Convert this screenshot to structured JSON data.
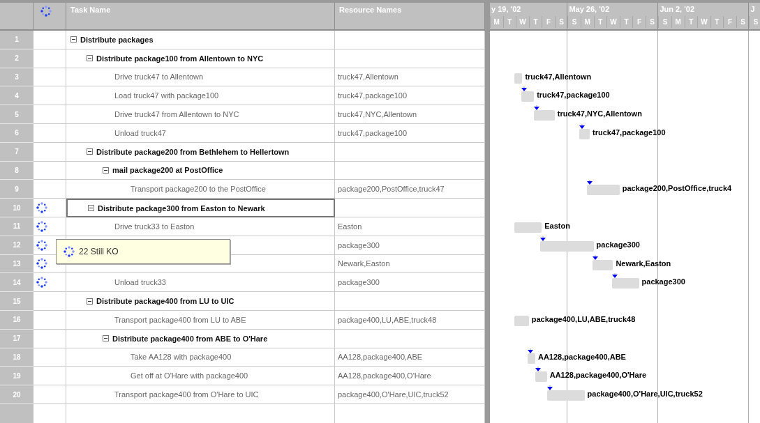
{
  "table": {
    "columns": [
      "Task Name",
      "Resource Names"
    ],
    "rows": [
      {
        "id": "1",
        "name": "Distribute packages",
        "indicator": false,
        "selected": false,
        "expanded": true,
        "children": [
          {
            "id": "2",
            "name": "Distribute package100 from Allentown to NYC",
            "indicator": false,
            "selected": false,
            "expanded": true,
            "children": [
              {
                "id": "3",
                "name": "Drive truck47 to Allentown",
                "resources": "truck47,Allentown",
                "indicator": false,
                "selected": false,
                "bar": {
                  "label": "truck47,Allentown",
                  "linked": false
                }
              },
              {
                "id": "4",
                "name": "Load truck47 with package100",
                "resources": "truck47,package100",
                "indicator": false,
                "selected": false,
                "bar": {
                  "label": "truck47,package100",
                  "linked": true
                }
              },
              {
                "id": "5",
                "name": "Drive truck47 from Allentown to NYC",
                "resources": "truck47,NYC,Allentown",
                "indicator": false,
                "selected": false,
                "bar": {
                  "label": "truck47,NYC,Allentown",
                  "linked": true
                }
              },
              {
                "id": "6",
                "name": "Unload truck47",
                "resources": "truck47,package100",
                "indicator": false,
                "selected": false,
                "bar": {
                  "label": "truck47,package100",
                  "linked": true
                }
              }
            ]
          },
          {
            "id": "7",
            "name": "Distribute package200 from Bethlehem to Hellertown",
            "indicator": false,
            "selected": false,
            "expanded": true,
            "children": [
              {
                "id": "8",
                "name": "mail package200 at PostOffice",
                "indicator": false,
                "selected": false,
                "expanded": true,
                "children": [
                  {
                    "id": "9",
                    "name": "Transport package200 to the PostOffice",
                    "resources": "package200,PostOffice,truck47",
                    "indicator": false,
                    "selected": false,
                    "bar": {
                      "label": "package200,PostOffice,truck4",
                      "linked": true
                    }
                  }
                ]
              }
            ]
          },
          {
            "id": "10",
            "name": "Distribute package300 from Easton to Newark",
            "indicator": true,
            "selected": true,
            "expanded": true,
            "children": [
              {
                "id": "11",
                "name": "Drive truck33 to Easton",
                "resources": "Easton",
                "indicator": true,
                "selected": false,
                "bar": {
                  "label": "Easton",
                  "linked": false
                }
              },
              {
                "id": "12",
                "resources": "package300",
                "indicator": true,
                "selected": false,
                "bar": {
                  "label": "package300",
                  "linked": true
                }
              },
              {
                "id": "13",
                "resources": "Newark,Easton",
                "indicator": true,
                "selected": false,
                "bar": {
                  "label": "Newark,Easton",
                  "linked": true
                }
              },
              {
                "id": "14",
                "name": "Unload truck33",
                "resources": "package300",
                "indicator": true,
                "selected": false,
                "bar": {
                  "label": "package300",
                  "linked": true
                }
              }
            ]
          },
          {
            "id": "15",
            "name": "Distribute package400 from LU to UIC",
            "indicator": false,
            "selected": false,
            "expanded": true,
            "children": [
              {
                "id": "16",
                "name": "Transport package400 from LU to ABE",
                "resources": "package400,LU,ABE,truck48",
                "indicator": false,
                "selected": false,
                "bar": {
                  "label": "package400,LU,ABE,truck48",
                  "linked": false
                }
              },
              {
                "id": "17",
                "name": "Distribute package400 from ABE to O'Hare",
                "indicator": false,
                "selected": false,
                "expanded": true,
                "children": [
                  {
                    "id": "18",
                    "name": "Take AA128 with package400",
                    "resources": "AA128,package400,ABE",
                    "indicator": false,
                    "selected": false,
                    "bar": {
                      "label": "AA128,package400,ABE",
                      "linked": true
                    }
                  },
                  {
                    "id": "19",
                    "name": "Get off at O'Hare with package400",
                    "resources": "AA128,package400,O'Hare",
                    "indicator": false,
                    "selected": false,
                    "bar": {
                      "label": "AA128,package400,O'Hare",
                      "linked": true
                    }
                  }
                ]
              },
              {
                "id": "20",
                "name": "Transport package400 from O'Hare to UIC",
                "resources": "package400,O'Hare,UIC,truck52",
                "indicator": false,
                "selected": false,
                "bar": {
                  "label": "package400,O'Hare,UIC,truck52",
                  "linked": true
                }
              }
            ]
          }
        ]
      }
    ]
  },
  "timescale": {
    "weeks": [
      {
        "label": "y 19, '02",
        "days": [
          "M",
          "T",
          "W",
          "T",
          "F",
          "S"
        ]
      },
      {
        "label": "May 26, '02",
        "days": [
          "S",
          "M",
          "T",
          "W",
          "T",
          "F",
          "S"
        ]
      },
      {
        "label": "Jun 2, '02",
        "days": [
          "S",
          "M",
          "T",
          "W",
          "T",
          "F",
          "S"
        ]
      },
      {
        "label": "J",
        "days": [
          "S"
        ]
      }
    ]
  },
  "tooltip": {
    "text": "22 Still KO"
  }
}
